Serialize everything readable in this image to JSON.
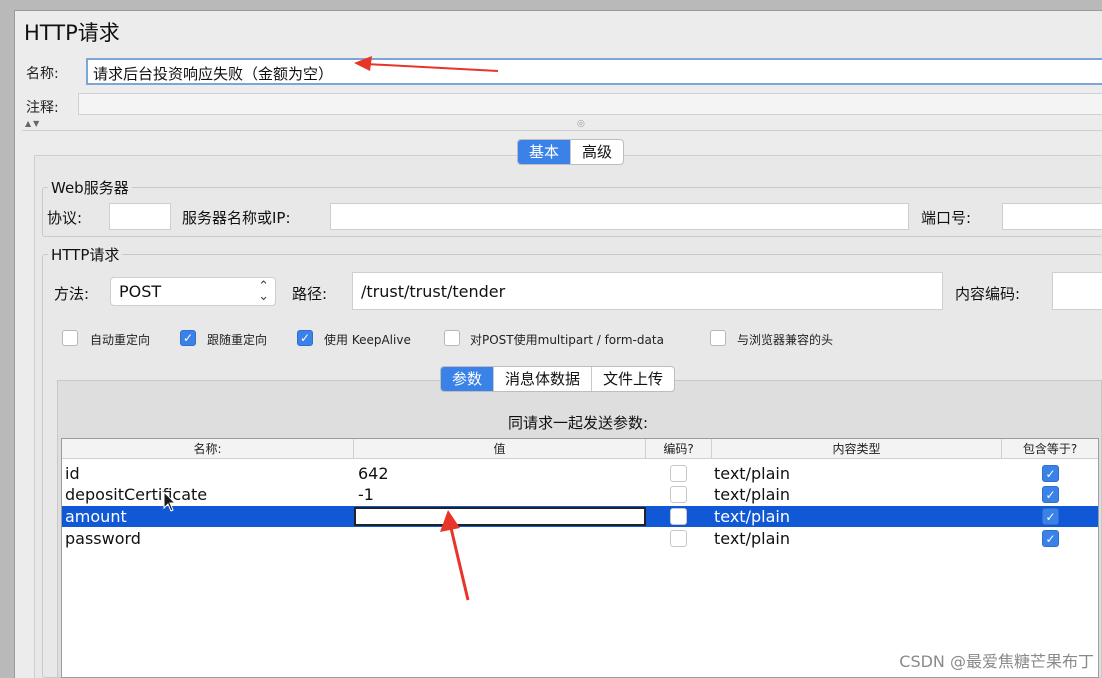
{
  "window": {
    "title": "HTTP请求"
  },
  "name_row": {
    "label": "名称:",
    "value": "请求后台投资响应失败（金额为空）"
  },
  "comment_row": {
    "label": "注释:",
    "value": ""
  },
  "tabs": [
    {
      "label": "基本",
      "active": true
    },
    {
      "label": "高级",
      "active": false
    }
  ],
  "web_server": {
    "title": "Web服务器",
    "protocol_label": "协议:",
    "protocol_value": "",
    "server_label": "服务器名称或IP:",
    "server_value": "",
    "port_label": "端口号:",
    "port_value": ""
  },
  "http_request": {
    "title": "HTTP请求",
    "method_label": "方法:",
    "method_value": "POST",
    "path_label": "路径:",
    "path_value": "/trust/trust/tender",
    "encoding_label": "内容编码:",
    "encoding_value": ""
  },
  "options": [
    {
      "label": "自动重定向",
      "checked": false
    },
    {
      "label": "跟随重定向",
      "checked": true
    },
    {
      "label": "使用 KeepAlive",
      "checked": true
    },
    {
      "label": "对POST使用multipart / form-data",
      "checked": false
    },
    {
      "label": "与浏览器兼容的头",
      "checked": false
    }
  ],
  "sub_tabs": [
    {
      "label": "参数",
      "active": true
    },
    {
      "label": "消息体数据",
      "active": false
    },
    {
      "label": "文件上传",
      "active": false
    }
  ],
  "params": {
    "caption": "同请求一起发送参数:",
    "columns": [
      "名称:",
      "值",
      "编码?",
      "内容类型",
      "包含等于?"
    ],
    "rows": [
      {
        "name": "id",
        "value": "642",
        "encode": false,
        "content_type": "text/plain",
        "include_equals": true,
        "selected": false
      },
      {
        "name": "depositCertificate",
        "value": "-1",
        "encode": false,
        "content_type": "text/plain",
        "include_equals": true,
        "selected": false
      },
      {
        "name": "amount",
        "value": "",
        "encode": false,
        "content_type": "text/plain",
        "include_equals": true,
        "selected": true
      },
      {
        "name": "password",
        "value": "",
        "encode": false,
        "content_type": "text/plain",
        "include_equals": true,
        "selected": false
      }
    ]
  },
  "watermark": "CSDN @最爱焦糖芒果布丁",
  "colors": {
    "accent": "#3b82e8",
    "selection": "#1158d6",
    "annotation_arrow": "#e8352a"
  },
  "icons": {
    "checkmark": "✓",
    "select_chevron": "⌃⌄"
  }
}
